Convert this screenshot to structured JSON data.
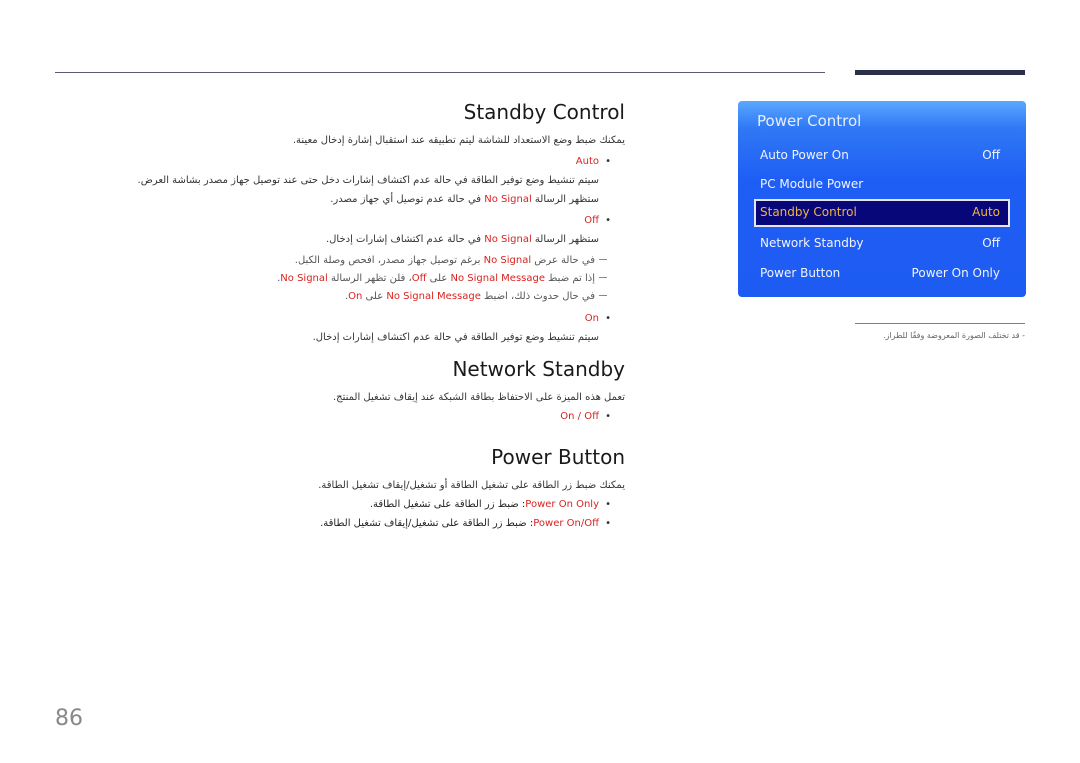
{
  "page_number": "86",
  "sections": {
    "standby": {
      "title": "Standby Control",
      "intro": "يمكنك ضبط وضع الاستعداد للشاشة ليتم تطبيقه عند استقبال إشارة إدخال معينة.",
      "auto": {
        "label": "Auto",
        "line1": "سيتم تنشيط وضع توفير الطاقة في حالة عدم اكتشاف إشارات دخل حتى عند توصيل جهاز مصدر بشاشة العرض.",
        "line2_pre": "ستظهر الرسالة ",
        "line2_hl": "No Signal",
        "line2_post": " في حالة عدم توصيل أي جهاز مصدر."
      },
      "off": {
        "label": "Off",
        "line_pre": "ستظهر الرسالة ",
        "line_hl": "No Signal",
        "line_post": " في حالة عدم اكتشاف إشارات إدخال.",
        "note1_pre": "في حالة عرض ",
        "note1_hl": "No Signal",
        "note1_post": " برغم توصيل جهاز مصدر، افحص وصلة الكبل.",
        "note2_a": "إذا تم ضبط ",
        "note2_b": "No Signal Message",
        "note2_c": " على ",
        "note2_d": "Off",
        "note2_e": "، فلن تظهر الرسالة ",
        "note2_f": "No Signal",
        "note2_g": ".",
        "note3_a": "في حال حدوث ذلك، اضبط ",
        "note3_b": "No Signal Message",
        "note3_c": " على ",
        "note3_d": "On",
        "note3_e": "."
      },
      "on": {
        "label": "On",
        "line": "سيتم تنشيط وضع توفير الطاقة في حالة عدم اكتشاف إشارات إدخال."
      }
    },
    "network": {
      "title": "Network Standby",
      "intro": "تعمل هذه الميزة على الاحتفاظ بطاقة الشبكة عند إيقاف تشغيل المنتج.",
      "options": "On / Off"
    },
    "power_button": {
      "title": "Power Button",
      "intro": "يمكنك ضبط زر الطاقة على تشغيل الطاقة أو تشغيل/إيقاف تشغيل الطاقة.",
      "opt1_label": "Power On Only",
      "opt1_text": ": ضبط زر الطاقة على تشغيل الطاقة.",
      "opt2_label": "Power On/Off",
      "opt2_text": ": ضبط زر الطاقة على تشغيل/إيقاف تشغيل الطاقة."
    }
  },
  "osd": {
    "title": "Power Control",
    "items": [
      {
        "label": "Auto Power On",
        "value": "Off"
      },
      {
        "label": "PC Module Power",
        "value": ""
      },
      {
        "label": "Standby Control",
        "value": "Auto",
        "selected": true
      },
      {
        "label": "Network Standby",
        "value": "Off"
      },
      {
        "label": "Power Button",
        "value": "Power On Only"
      }
    ],
    "colors": {
      "selected_text": "#f3b43a",
      "selected_bg": "#07077a",
      "panel": "#1f5ef5"
    }
  },
  "side_note": "-  قد تختلف الصورة المعروضة وفقًا للطراز."
}
